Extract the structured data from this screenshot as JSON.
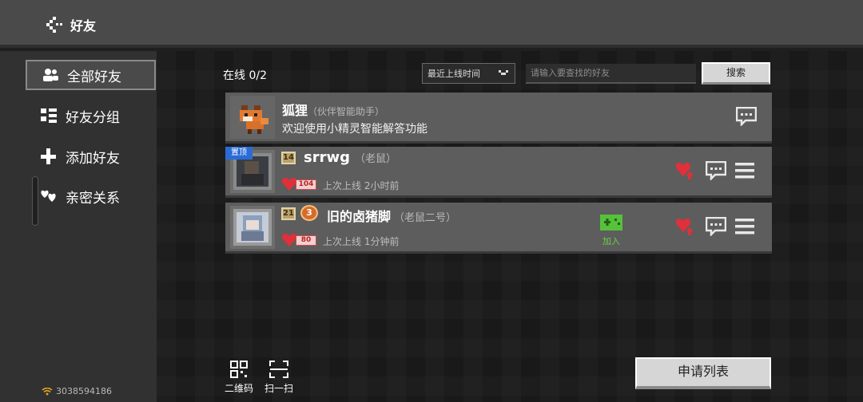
{
  "header": {
    "title": "好友"
  },
  "sidebar": {
    "items": [
      {
        "label": "全部好友",
        "icon": "people-icon"
      },
      {
        "label": "好友分组",
        "icon": "group-icon"
      },
      {
        "label": "添加好友",
        "icon": "plus-icon"
      },
      {
        "label": "亲密关系",
        "icon": "hearts-icon"
      }
    ],
    "user_id": "3038594186"
  },
  "main": {
    "online_count": "在线 0/2",
    "sort_label": "最近上线时间",
    "search_placeholder": "请输入要查找的好友",
    "search_button": "搜索",
    "assistant": {
      "name": "狐狸",
      "tag": "（伙伴智能助手）",
      "message": "欢迎使用小精灵智能解答功能"
    },
    "friends": [
      {
        "pinned_label": "置顶",
        "level": "14",
        "name": "srrwg",
        "nickname": "（老鼠）",
        "intimacy": "104",
        "last_online": "上次上线 2小时前"
      },
      {
        "level": "21",
        "rank": "3",
        "name": "旧的卤猪脚",
        "nickname": "（老鼠二号）",
        "intimacy": "80",
        "last_online": "上次上线 1分钟前",
        "join_label": "加入"
      }
    ],
    "qr_label": "二维码",
    "scan_label": "扫一扫",
    "apply_list_button": "申请列表"
  },
  "colors": {
    "header_bg": "#4a4a4a",
    "card_bg": "#5d5d5d",
    "heart_red": "#e0303a",
    "join_green": "#55c23a",
    "pin_blue": "#2b6bd6"
  }
}
